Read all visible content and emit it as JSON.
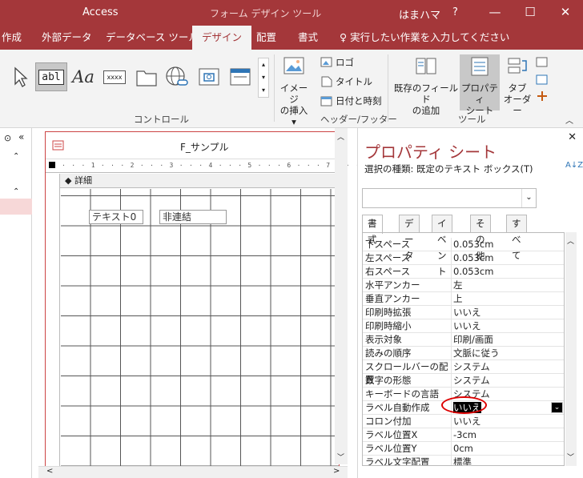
{
  "titlebar": {
    "app": "Access",
    "context": "フォーム デザイン ツール",
    "user": "はまハマ",
    "help": "?",
    "minimize": "—",
    "maximize": "☐",
    "close": "✕"
  },
  "tabs": [
    {
      "label": "作成"
    },
    {
      "label": "外部データ"
    },
    {
      "label": "データベース ツール"
    },
    {
      "label": "デザイン"
    },
    {
      "label": "配置"
    },
    {
      "label": "書式"
    }
  ],
  "tellme": "♀ 実行したい作業を入力してください",
  "ribbon": {
    "controls_group": "コントロール",
    "textbox_label": "abl",
    "label_label": "Aa",
    "button_label": "xxxx",
    "image_insert": "イメージ\nの挿入",
    "image_insert_l1": "イメージ",
    "image_insert_l2": "の挿入 ▾",
    "logo": "ロゴ",
    "title": "タイトル",
    "datetime": "日付と時刻",
    "header_footer_group": "ヘッダー/フッター",
    "existing_fields_l1": "既存のフィールド",
    "existing_fields_l2": "の追加",
    "property_sheet_l1": "プロパティ",
    "property_sheet_l2": "シート",
    "tab_order_l1": "タブ",
    "tab_order_l2": "オーダー",
    "tools_group": "ツール"
  },
  "form": {
    "name": "F_サンプル",
    "section": "◆ 詳細",
    "ruler_marks": "· · · 1 · · · 2 · · · 3 · · · 4 · · · 5 · · · 6 · · · 7 · · · 8 · · · 9",
    "label_control": "テキスト0",
    "textbox_control": "非連結"
  },
  "property_sheet": {
    "title": "プロパティ シート",
    "selection_type": "選択の種類:  既定のテキスト ボックス(T)",
    "tabs": [
      "書式",
      "データ",
      "イベント",
      "その他",
      "すべて"
    ],
    "rows": [
      {
        "k": "下スペース",
        "v": "0.053cm"
      },
      {
        "k": "左スペース",
        "v": "0.053cm"
      },
      {
        "k": "右スペース",
        "v": "0.053cm"
      },
      {
        "k": "水平アンカー",
        "v": "左"
      },
      {
        "k": "垂直アンカー",
        "v": "上"
      },
      {
        "k": "印刷時拡張",
        "v": "いいえ"
      },
      {
        "k": "印刷時縮小",
        "v": "いいえ"
      },
      {
        "k": "表示対象",
        "v": "印刷/画面"
      },
      {
        "k": "読みの順序",
        "v": "文脈に従う"
      },
      {
        "k": "スクロールバーの配置",
        "v": "システム"
      },
      {
        "k": "数字の形態",
        "v": "システム"
      },
      {
        "k": "キーボードの言語",
        "v": "システム"
      },
      {
        "k": "ラベル自動作成",
        "v": "いいえ"
      },
      {
        "k": "コロン付加",
        "v": "いいえ"
      },
      {
        "k": "ラベル位置X",
        "v": "-3cm"
      },
      {
        "k": "ラベル位置Y",
        "v": "0cm"
      },
      {
        "k": "ラベル文字配置",
        "v": "標準"
      }
    ],
    "sort_icon": "A↓Z",
    "close": "✕"
  }
}
